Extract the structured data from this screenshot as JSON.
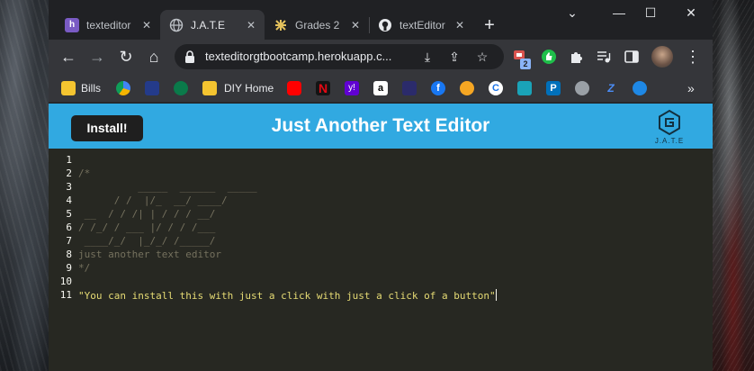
{
  "browser": {
    "tabs": [
      {
        "label": "texteditor",
        "icon": "heroku-icon"
      },
      {
        "label": "J.A.T.E",
        "icon": "globe-icon"
      },
      {
        "label": "Grades 2",
        "icon": "canvas-icon"
      },
      {
        "label": "textEditor",
        "icon": "github-icon"
      }
    ],
    "new_tab": "+",
    "window_controls": [
      "⌄",
      "—",
      "☐",
      "✕"
    ],
    "url": "texteditorgtbootcamp.herokuapp.c...",
    "extension_badge": "2",
    "bookmarks": [
      {
        "label": "Bills",
        "icon": "folder-icon"
      },
      {
        "label": "DIY Home",
        "icon": "folder-icon"
      }
    ],
    "more_bookmarks": "»"
  },
  "app": {
    "install_label": "Install!",
    "title": "Just Another Text Editor",
    "logo_text": "J.A.T.E"
  },
  "editor": {
    "lines": [
      {
        "n": "1",
        "text": "",
        "type": "plain"
      },
      {
        "n": "2",
        "text": "/*",
        "type": "comment"
      },
      {
        "n": "3",
        "text": "          _____  ______  _____",
        "type": "comment"
      },
      {
        "n": "4",
        "text": "      / /  |/_  __/ ____/",
        "type": "comment"
      },
      {
        "n": "5",
        "text": " __  / / /| | / / / __/",
        "type": "comment"
      },
      {
        "n": "6",
        "text": "/ /_/ / ___ |/ / / /___",
        "type": "comment"
      },
      {
        "n": "7",
        "text": " ____/_/  |_/_/ /_____/",
        "type": "comment"
      },
      {
        "n": "8",
        "text": "just another text editor",
        "type": "comment"
      },
      {
        "n": "9",
        "text": "*/",
        "type": "comment"
      },
      {
        "n": "10",
        "text": "",
        "type": "plain"
      },
      {
        "n": "11",
        "text": "\"You can install this with just a click with just a click of a button\"",
        "type": "string"
      }
    ]
  },
  "colors": {
    "app_bar": "#31a9e1",
    "editor_bg": "#272822",
    "comment": "#75715e",
    "string": "#e6db74"
  }
}
